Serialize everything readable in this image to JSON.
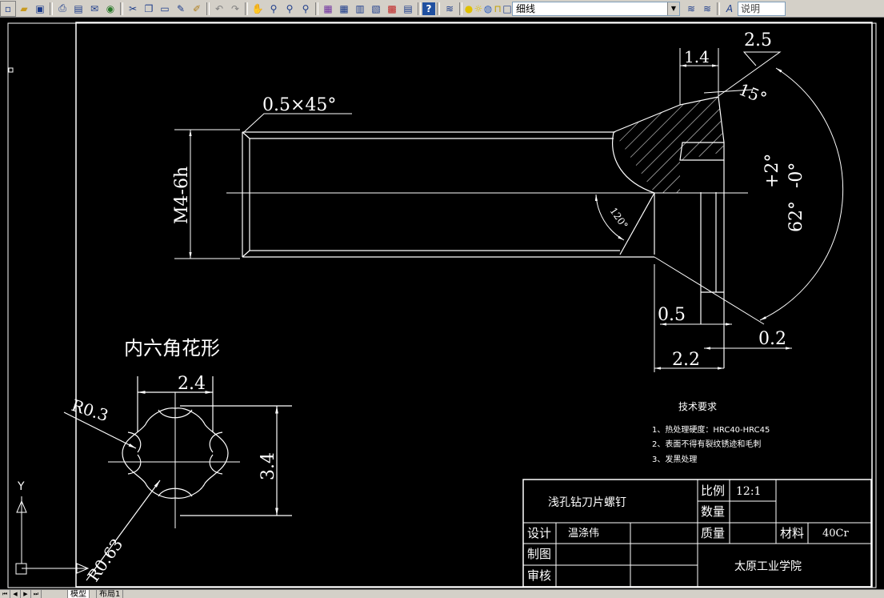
{
  "toolbar": {
    "layer_name": "细线",
    "text_style": "说明",
    "icons": [
      "new-file-icon",
      "open-folder-icon",
      "save-icon",
      "print-icon",
      "print-preview-icon",
      "publish-icon",
      "web-icon",
      "cut-icon",
      "copy-icon",
      "paste-icon",
      "match-properties-icon",
      "brush-icon",
      "undo-icon",
      "redo-icon",
      "pan-icon",
      "zoom-realtime-icon",
      "zoom-window-icon",
      "zoom-previous-icon",
      "properties-icon",
      "design-center-icon",
      "tool-palette-icon",
      "sheet-set-icon",
      "markup-icon",
      "calculator-icon",
      "help-icon",
      "layer-manager-icon",
      "bulb-icon",
      "sun-icon",
      "freeze-icon",
      "lock-icon",
      "color-square-icon",
      "layer-previous-icon",
      "layer-state-icon",
      "text-style-icon"
    ]
  },
  "drawing": {
    "labels": {
      "chamfer": "0.5×45°",
      "thread": "M4-6h",
      "angle_120": "120°",
      "dim_1_4": "1.4",
      "dim_2_5": "2.5",
      "angle_15": "15°",
      "angle_62": "62°",
      "tol_62_plus": "+2°",
      "tol_62_minus": "-0°",
      "dim_0_5": "0.5",
      "dim_0_2": "0.2",
      "dim_2_2": "2.2",
      "section_title": "内六角花形",
      "dim_2_4": "2.4",
      "dim_3_4": "3.4",
      "radius_03": "R0.3",
      "radius_063": "R0.63",
      "ucs_y": "Y"
    },
    "tech_requirements": {
      "title": "技术要求",
      "items": [
        "1、热处理硬度：HRC40-HRC45",
        "2、表面不得有裂纹锈迹和毛刺",
        "3、发黑处理"
      ]
    },
    "title_block": {
      "part_name": "浅孔钻刀片螺钉",
      "scale_label": "比例",
      "scale_value": "12:1",
      "quantity_label": "数量",
      "design_label": "设计",
      "designer": "温涤伟",
      "mass_label": "质量",
      "material_label": "材料",
      "material_value": "40Cr",
      "drawing_label": "制图",
      "review_label": "审核",
      "school": "太原工业学院"
    }
  },
  "tabs": {
    "model": "模型",
    "layout1": "布局1"
  }
}
